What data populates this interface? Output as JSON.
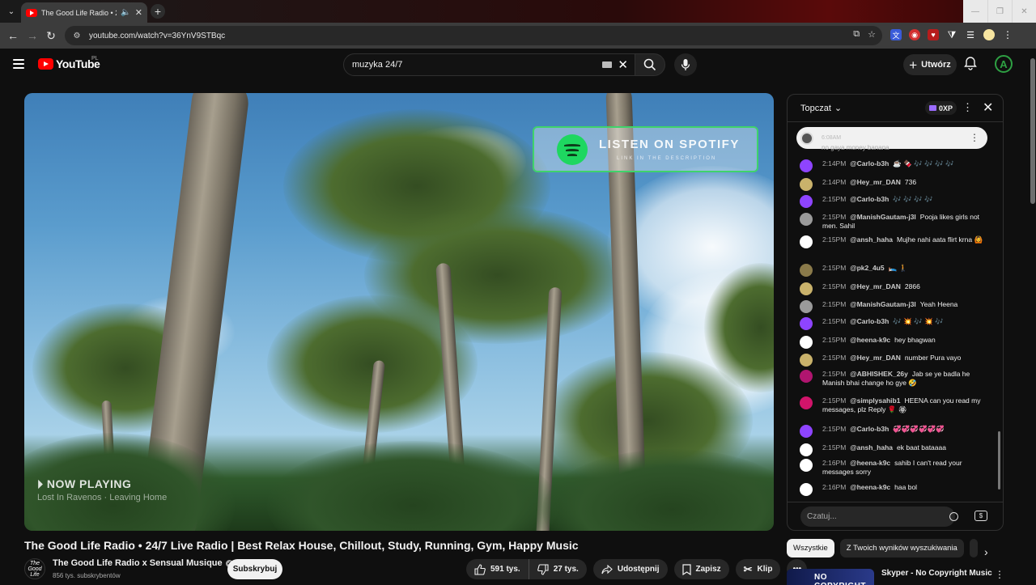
{
  "browser": {
    "tab_title": "The Good Life Radio • 24/7",
    "url": "youtube.com/watch?v=36YnV9STBqc"
  },
  "masthead": {
    "logo_text": "YouTube",
    "country": "PL",
    "search_value": "muzyka 24/7",
    "create_label": "Utwórz",
    "avatar_letter": "A"
  },
  "player": {
    "spotify_title": "LISTEN ON SPOTIFY",
    "spotify_sub": "LINK IN THE DESCRIPTION",
    "now_playing": "NOW PLAYING",
    "now_track": "Lost In Ravenos · Leaving Home"
  },
  "video": {
    "title": "The Good Life Radio • 24/7 Live Radio | Best Relax House, Chillout, Study, Running, Gym, Happy Music",
    "channel_name": "The Good Life Radio x Sensual Musique",
    "channel_avatar_text": "The Good Life",
    "subscribers": "856 tys. subskrybentów",
    "subscribe_label": "Subskrybuj",
    "likes": "591 tys.",
    "dislikes": "27 tys.",
    "share_label": "Udostępnij",
    "save_label": "Zapisz",
    "clip_label": "Klip"
  },
  "chat": {
    "mode": "Topczat",
    "xp": "0XP",
    "pinned_time": "6:08AM",
    "ghost_line": "no gaya money banana",
    "input_placeholder": "Czatuj...",
    "messages": [
      {
        "time": "2:14PM",
        "author": "@Carlo-b3h",
        "text": "☕ 🍫 🎶 🎶 🎶 🎶",
        "color": "#8e44ff"
      },
      {
        "time": "2:14PM",
        "author": "@Hey_mr_DAN",
        "text": "736",
        "color": "#c9b26b"
      },
      {
        "time": "2:15PM",
        "author": "@Carlo-b3h",
        "text": "🎶 🎶 🎶 🎶",
        "color": "#8e44ff"
      },
      {
        "time": "2:15PM",
        "author": "@ManishGautam-j3l",
        "text": "Pooja likes girls not men. Sahil",
        "color": "#9a9a9a"
      },
      {
        "time": "2:15PM",
        "author": "@ansh_haha",
        "text": "Mujhe nahi aata flirt krna 🙆",
        "color": "#ffffff"
      },
      {
        "time": "2:15PM",
        "author": "@pk2_4u5",
        "text": "🛌 🚶",
        "color": "#8a7a4a"
      },
      {
        "time": "2:15PM",
        "author": "@Hey_mr_DAN",
        "text": "2866",
        "color": "#c9b26b"
      },
      {
        "time": "2:15PM",
        "author": "@ManishGautam-j3l",
        "text": "Yeah Heena",
        "color": "#9a9a9a"
      },
      {
        "time": "2:15PM",
        "author": "@Carlo-b3h",
        "text": "🎶 💥 🎶 💥 🎶",
        "color": "#8e44ff"
      },
      {
        "time": "2:15PM",
        "author": "@heena-k9c",
        "text": "hey bhagwan",
        "color": "#ffffff"
      },
      {
        "time": "2:15PM",
        "author": "@Hey_mr_DAN",
        "text": "number Pura vayo",
        "color": "#c9b26b"
      },
      {
        "time": "2:15PM",
        "author": "@ABHISHEK_26y",
        "text": "Jab se ye badla he Manish bhai change ho gye 🤣",
        "color": "#b0156f"
      },
      {
        "time": "2:15PM",
        "author": "@simplysahib1",
        "text": "HEENA can you read my messages, plz Reply 🌹 🏵",
        "color": "#d1146a"
      },
      {
        "time": "2:15PM",
        "author": "@Carlo-b3h",
        "text": "💞💞💞💞💞💞",
        "color": "#8e44ff"
      },
      {
        "time": "2:15PM",
        "author": "@ansh_haha",
        "text": "ek baat bataaaa",
        "color": "#ffffff"
      },
      {
        "time": "2:16PM",
        "author": "@heena-k9c",
        "text": "sahib I can't read your messages sorry",
        "color": "#ffffff"
      },
      {
        "time": "2:16PM",
        "author": "@heena-k9c",
        "text": "haa bol",
        "color": "#ffffff"
      }
    ]
  },
  "chips": [
    "Wszystkie",
    "Z Twoich wyników wyszukiwania"
  ],
  "related": {
    "thumb_text": "NO COPYRIGHT",
    "title": "Skyper - No Copyright Music"
  }
}
